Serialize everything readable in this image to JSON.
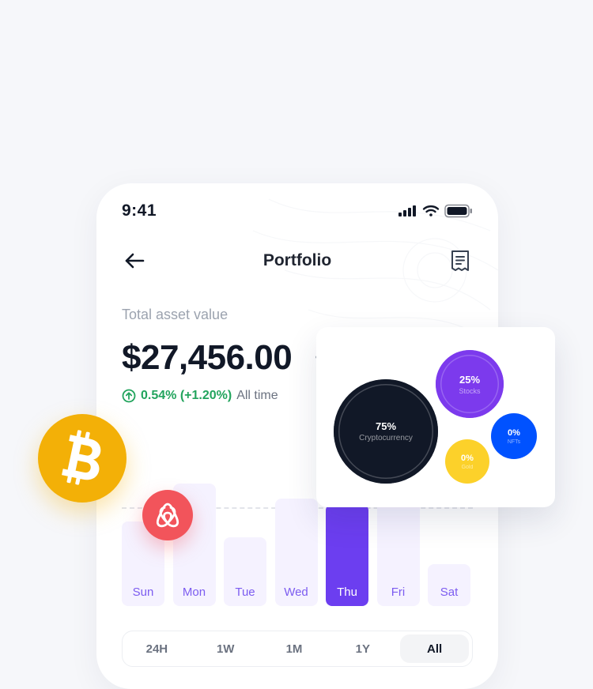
{
  "status_bar": {
    "time": "9:41"
  },
  "header": {
    "title": "Portfolio"
  },
  "summary": {
    "label": "Total asset value",
    "value": "$27,456.00",
    "change_positive": "0.54% (+1.20%)",
    "change_range": "All time"
  },
  "chart_data": {
    "type": "bar",
    "categories": [
      "Sun",
      "Mon",
      "Tue",
      "Wed",
      "Thu",
      "Fri",
      "Sat"
    ],
    "values": [
      0.63,
      0.91,
      0.51,
      0.8,
      0.76,
      0.78,
      0.31
    ],
    "active_index": 4,
    "colors": {
      "bar": "#f5f2ff",
      "active": "#6c3ef0",
      "label": "#7c5cf0"
    }
  },
  "period_tabs": [
    "24H",
    "1W",
    "1M",
    "1Y",
    "All"
  ],
  "period_active": 4,
  "allocation": [
    {
      "pct": "75%",
      "label": "Cryptocurrency",
      "color": "#111827"
    },
    {
      "pct": "25%",
      "label": "Stocks",
      "color": "#7c3aed"
    },
    {
      "pct": "0%",
      "label": "NFTs",
      "color": "#0052ff"
    },
    {
      "pct": "0%",
      "label": "Gold",
      "color": "#fcd12a"
    }
  ],
  "icons": {
    "back": "arrow-left-icon",
    "receipt": "receipt-icon",
    "up": "arrow-up-circle-icon",
    "bitcoin": "bitcoin-icon",
    "airbnb": "airbnb-icon"
  }
}
